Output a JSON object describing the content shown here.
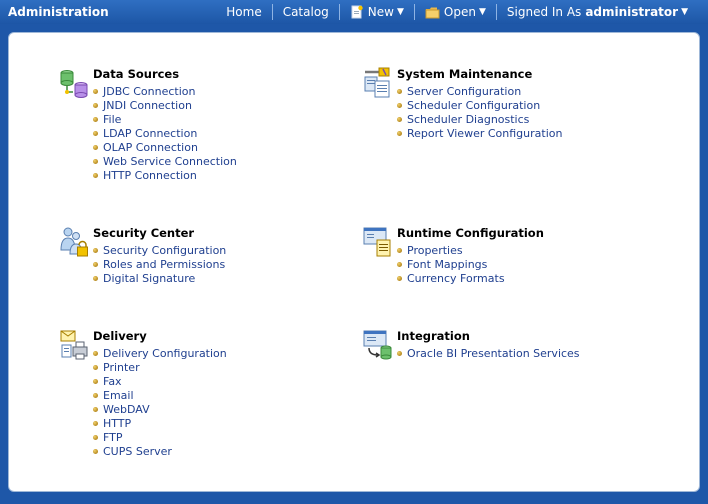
{
  "header": {
    "app_title": "Administration",
    "home": "Home",
    "catalog": "Catalog",
    "new": "New",
    "open": "Open",
    "signed_in_as": "Signed In As",
    "username": "administrator"
  },
  "sections": {
    "data_sources": {
      "title": "Data Sources",
      "links": [
        "JDBC Connection",
        "JNDI Connection",
        "File",
        "LDAP Connection",
        "OLAP Connection",
        "Web Service Connection",
        "HTTP Connection"
      ]
    },
    "system_maintenance": {
      "title": "System Maintenance",
      "links": [
        "Server Configuration",
        "Scheduler Configuration",
        "Scheduler Diagnostics",
        "Report Viewer Configuration"
      ]
    },
    "security_center": {
      "title": "Security Center",
      "links": [
        "Security Configuration",
        "Roles and Permissions",
        "Digital Signature"
      ]
    },
    "runtime_configuration": {
      "title": "Runtime Configuration",
      "links": [
        "Properties",
        "Font Mappings",
        "Currency Formats"
      ]
    },
    "delivery": {
      "title": "Delivery",
      "links": [
        "Delivery Configuration",
        "Printer",
        "Fax",
        "Email",
        "WebDAV",
        "HTTP",
        "FTP",
        "CUPS Server"
      ]
    },
    "integration": {
      "title": "Integration",
      "links": [
        "Oracle BI Presentation Services"
      ]
    }
  }
}
